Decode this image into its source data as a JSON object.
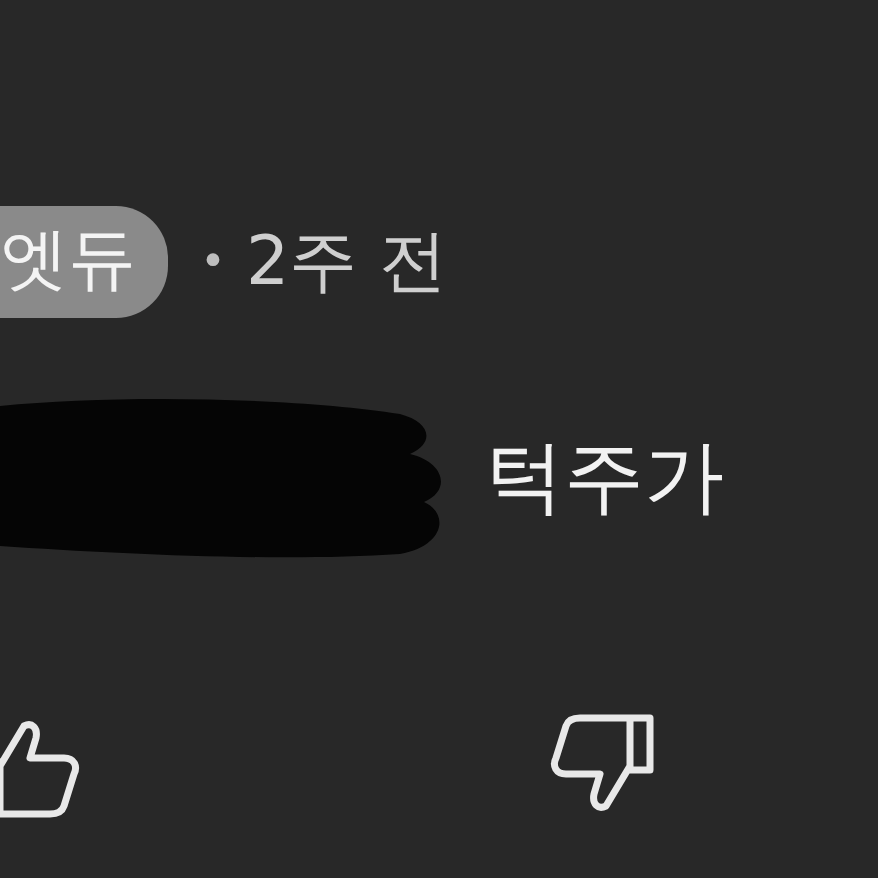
{
  "comment": {
    "author": "엣듀",
    "separator": "•",
    "time": "2주 전",
    "text": "턱주가"
  }
}
